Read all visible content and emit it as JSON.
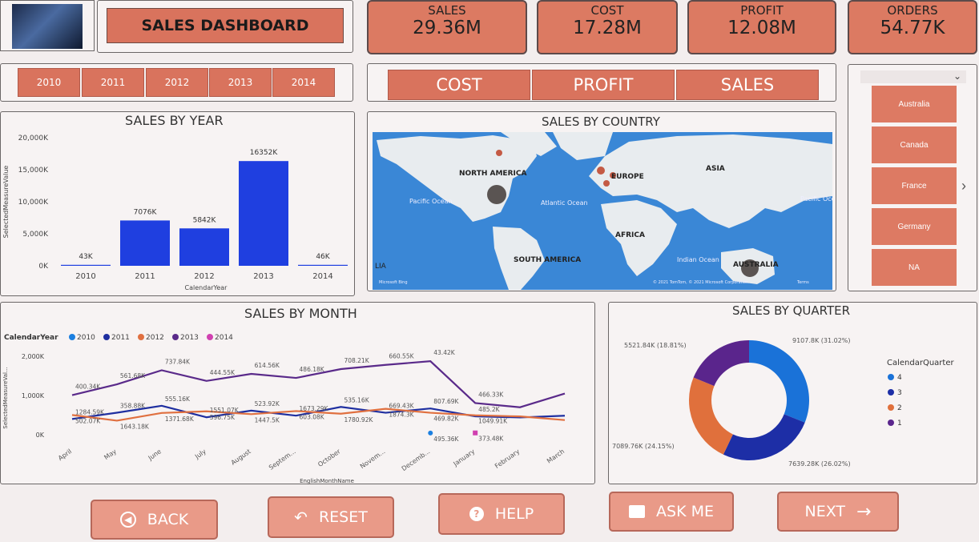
{
  "header": {
    "title": "SALES DASHBOARD",
    "kpis": [
      {
        "label": "SALES",
        "value": "29.36M"
      },
      {
        "label": "COST",
        "value": "17.28M"
      },
      {
        "label": "PROFIT",
        "value": "12.08M"
      },
      {
        "label": "ORDERS",
        "value": "54.77K"
      }
    ]
  },
  "year_filter": [
    "2010",
    "2011",
    "2012",
    "2013",
    "2014"
  ],
  "measure_buttons": [
    "COST",
    "PROFIT",
    "SALES"
  ],
  "country_slicer": {
    "items": [
      "Australia",
      "Canada",
      "France",
      "Germany",
      "NA"
    ]
  },
  "nav": {
    "back": "BACK",
    "reset": "RESET",
    "help": "HELP",
    "ask": "ASK ME",
    "next": "NEXT"
  },
  "map": {
    "title": "SALES BY COUNTRY",
    "labels": [
      "NORTH AMERICA",
      "EUROPE",
      "ASIA",
      "AFRICA",
      "SOUTH AMERICA",
      "AUSTRALIA",
      "Pacific Ocean",
      "Atlantic Ocean",
      "Indian Ocean",
      "Pacific Ocean",
      "LIA"
    ],
    "credit": "Microsoft Bing",
    "copyright": "© 2021 TomTom, © 2021 Microsoft Corporation",
    "terms": "Terms"
  },
  "chart_data": [
    {
      "type": "bar",
      "title": "SALES BY YEAR",
      "xlabel": "CalendarYear",
      "ylabel": "SelectedMeasureValue",
      "categories": [
        "2010",
        "2011",
        "2012",
        "2013",
        "2014"
      ],
      "values": [
        43,
        7076,
        5842,
        16352,
        46
      ],
      "value_labels": [
        "43K",
        "7076K",
        "5842K",
        "16352K",
        "46K"
      ],
      "ylim": [
        0,
        20000
      ],
      "yticks": [
        "0K",
        "5,000K",
        "10,000K",
        "15,000K",
        "20,000K"
      ],
      "color": "#1f3fe0"
    },
    {
      "type": "line",
      "title": "SALES BY MONTH",
      "xlabel": "EnglishMonthName",
      "ylabel": "SelectedMeasureVal...",
      "legend_title": "CalendarYear",
      "categories": [
        "April",
        "May",
        "June",
        "July",
        "August",
        "Septem...",
        "October",
        "Novem...",
        "Decemb...",
        "January",
        "February",
        "March"
      ],
      "ylim": [
        0,
        2000
      ],
      "yticks": [
        "0K",
        "1,000K",
        "2,000K"
      ],
      "series": [
        {
          "name": "2010",
          "color": "#1b7fe0",
          "values": [
            null,
            null,
            null,
            null,
            null,
            null,
            null,
            null,
            43.42,
            null,
            null,
            null
          ]
        },
        {
          "name": "2011",
          "color": "#1f2fa0",
          "values": [
            400.34,
            561.68,
            737.84,
            444.55,
            614.56,
            486.18,
            708.21,
            560.0,
            669.43,
            469.82,
            440.0,
            485.2
          ]
        },
        {
          "name": "2012",
          "color": "#e07040",
          "values": [
            502.07,
            358.88,
            555.16,
            596.75,
            523.92,
            603.08,
            535.16,
            660.55,
            560.0,
            495.36,
            466.33,
            373.48
          ]
        },
        {
          "name": "2013",
          "color": "#5a2a8a",
          "values": [
            1008.0,
            1284.59,
            1643.18,
            1371.68,
            1551.07,
            1447.5,
            1673.29,
            1780.92,
            1874.3,
            807.69,
            700.0,
            1049.91
          ]
        },
        {
          "name": "2014",
          "color": "#d040b0",
          "values": [
            null,
            null,
            null,
            null,
            null,
            null,
            null,
            null,
            null,
            46.0,
            null,
            null
          ]
        }
      ],
      "data_labels": [
        "400.34K",
        "502.07K",
        "1284.59K",
        "561.68K",
        "358.88K",
        "1643.18K",
        "737.84K",
        "555.16K",
        "1371.68K",
        "444.55K",
        "596.75K",
        "1551.07K",
        "614.56K",
        "523.92K",
        "1447.5K",
        "486.18K",
        "603.08K",
        "1673.29K",
        "708.21K",
        "535.16K",
        "1780.92K",
        "660.55K",
        "1874.3K",
        "669.43K",
        "43.42K",
        "807.69K",
        "469.82K",
        "495.36K",
        "466.33K",
        "1049.91K",
        "485.2K",
        "373.48K"
      ]
    },
    {
      "type": "pie",
      "title": "SALES BY QUARTER",
      "legend_title": "CalendarQuarter",
      "categories": [
        "4",
        "3",
        "2",
        "1"
      ],
      "values": [
        9107.8,
        7639.28,
        7089.76,
        5521.84
      ],
      "labels": [
        "9107.8K (31.02%)",
        "7639.28K (26.02%)",
        "7089.76K (24.15%)",
        "5521.84K (18.81%)"
      ],
      "colors": [
        "#1a72d8",
        "#1d2ea6",
        "#e0703c",
        "#5a258c"
      ]
    }
  ]
}
